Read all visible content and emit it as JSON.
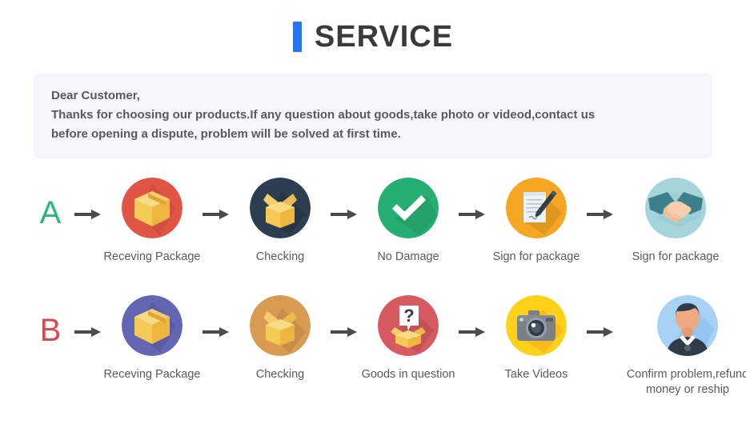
{
  "header": {
    "accent_color": "#2b74f0",
    "title": "SERVICE"
  },
  "notice": {
    "line1": "Dear Customer,",
    "line2": "Thanks for choosing our products.If any question about goods,take photo or videod,contact us",
    "line3": "before opening a dispute, problem will be solved at first time.",
    "background_color": "#f5f6f9"
  },
  "rows": [
    {
      "letter": "A",
      "letter_color": "#2eb67d",
      "steps": [
        {
          "label": "Receving Package",
          "icon": "closed-box-icon",
          "circle_color": "#e05543"
        },
        {
          "label": "Checking",
          "icon": "open-box-icon",
          "circle_color": "#2c3e50"
        },
        {
          "label": "No Damage",
          "icon": "check-mark-icon",
          "circle_color": "#27ae73"
        },
        {
          "label": "Sign for package",
          "icon": "document-pen-icon",
          "circle_color": "#f5a623"
        },
        {
          "label": "Sign for package",
          "icon": "handshake-icon",
          "circle_color": "#a5d5db"
        }
      ]
    },
    {
      "letter": "B",
      "letter_color": "#e0454d",
      "steps": [
        {
          "label": "Receving Package",
          "icon": "closed-box-icon",
          "circle_color": "#6366b5"
        },
        {
          "label": "Checking",
          "icon": "open-box-icon",
          "circle_color": "#d99a52"
        },
        {
          "label": "Goods in question",
          "icon": "question-box-icon",
          "circle_color": "#d65a5f"
        },
        {
          "label": "Take Videos",
          "icon": "camera-icon",
          "circle_color": "#ffd119"
        },
        {
          "label": "Confirm problem,refund money or reship",
          "icon": "person-icon",
          "circle_color": "#a8d2f5"
        }
      ]
    }
  ],
  "arrow": {
    "name": "arrow-right-icon",
    "color": "#4a4a4a"
  }
}
